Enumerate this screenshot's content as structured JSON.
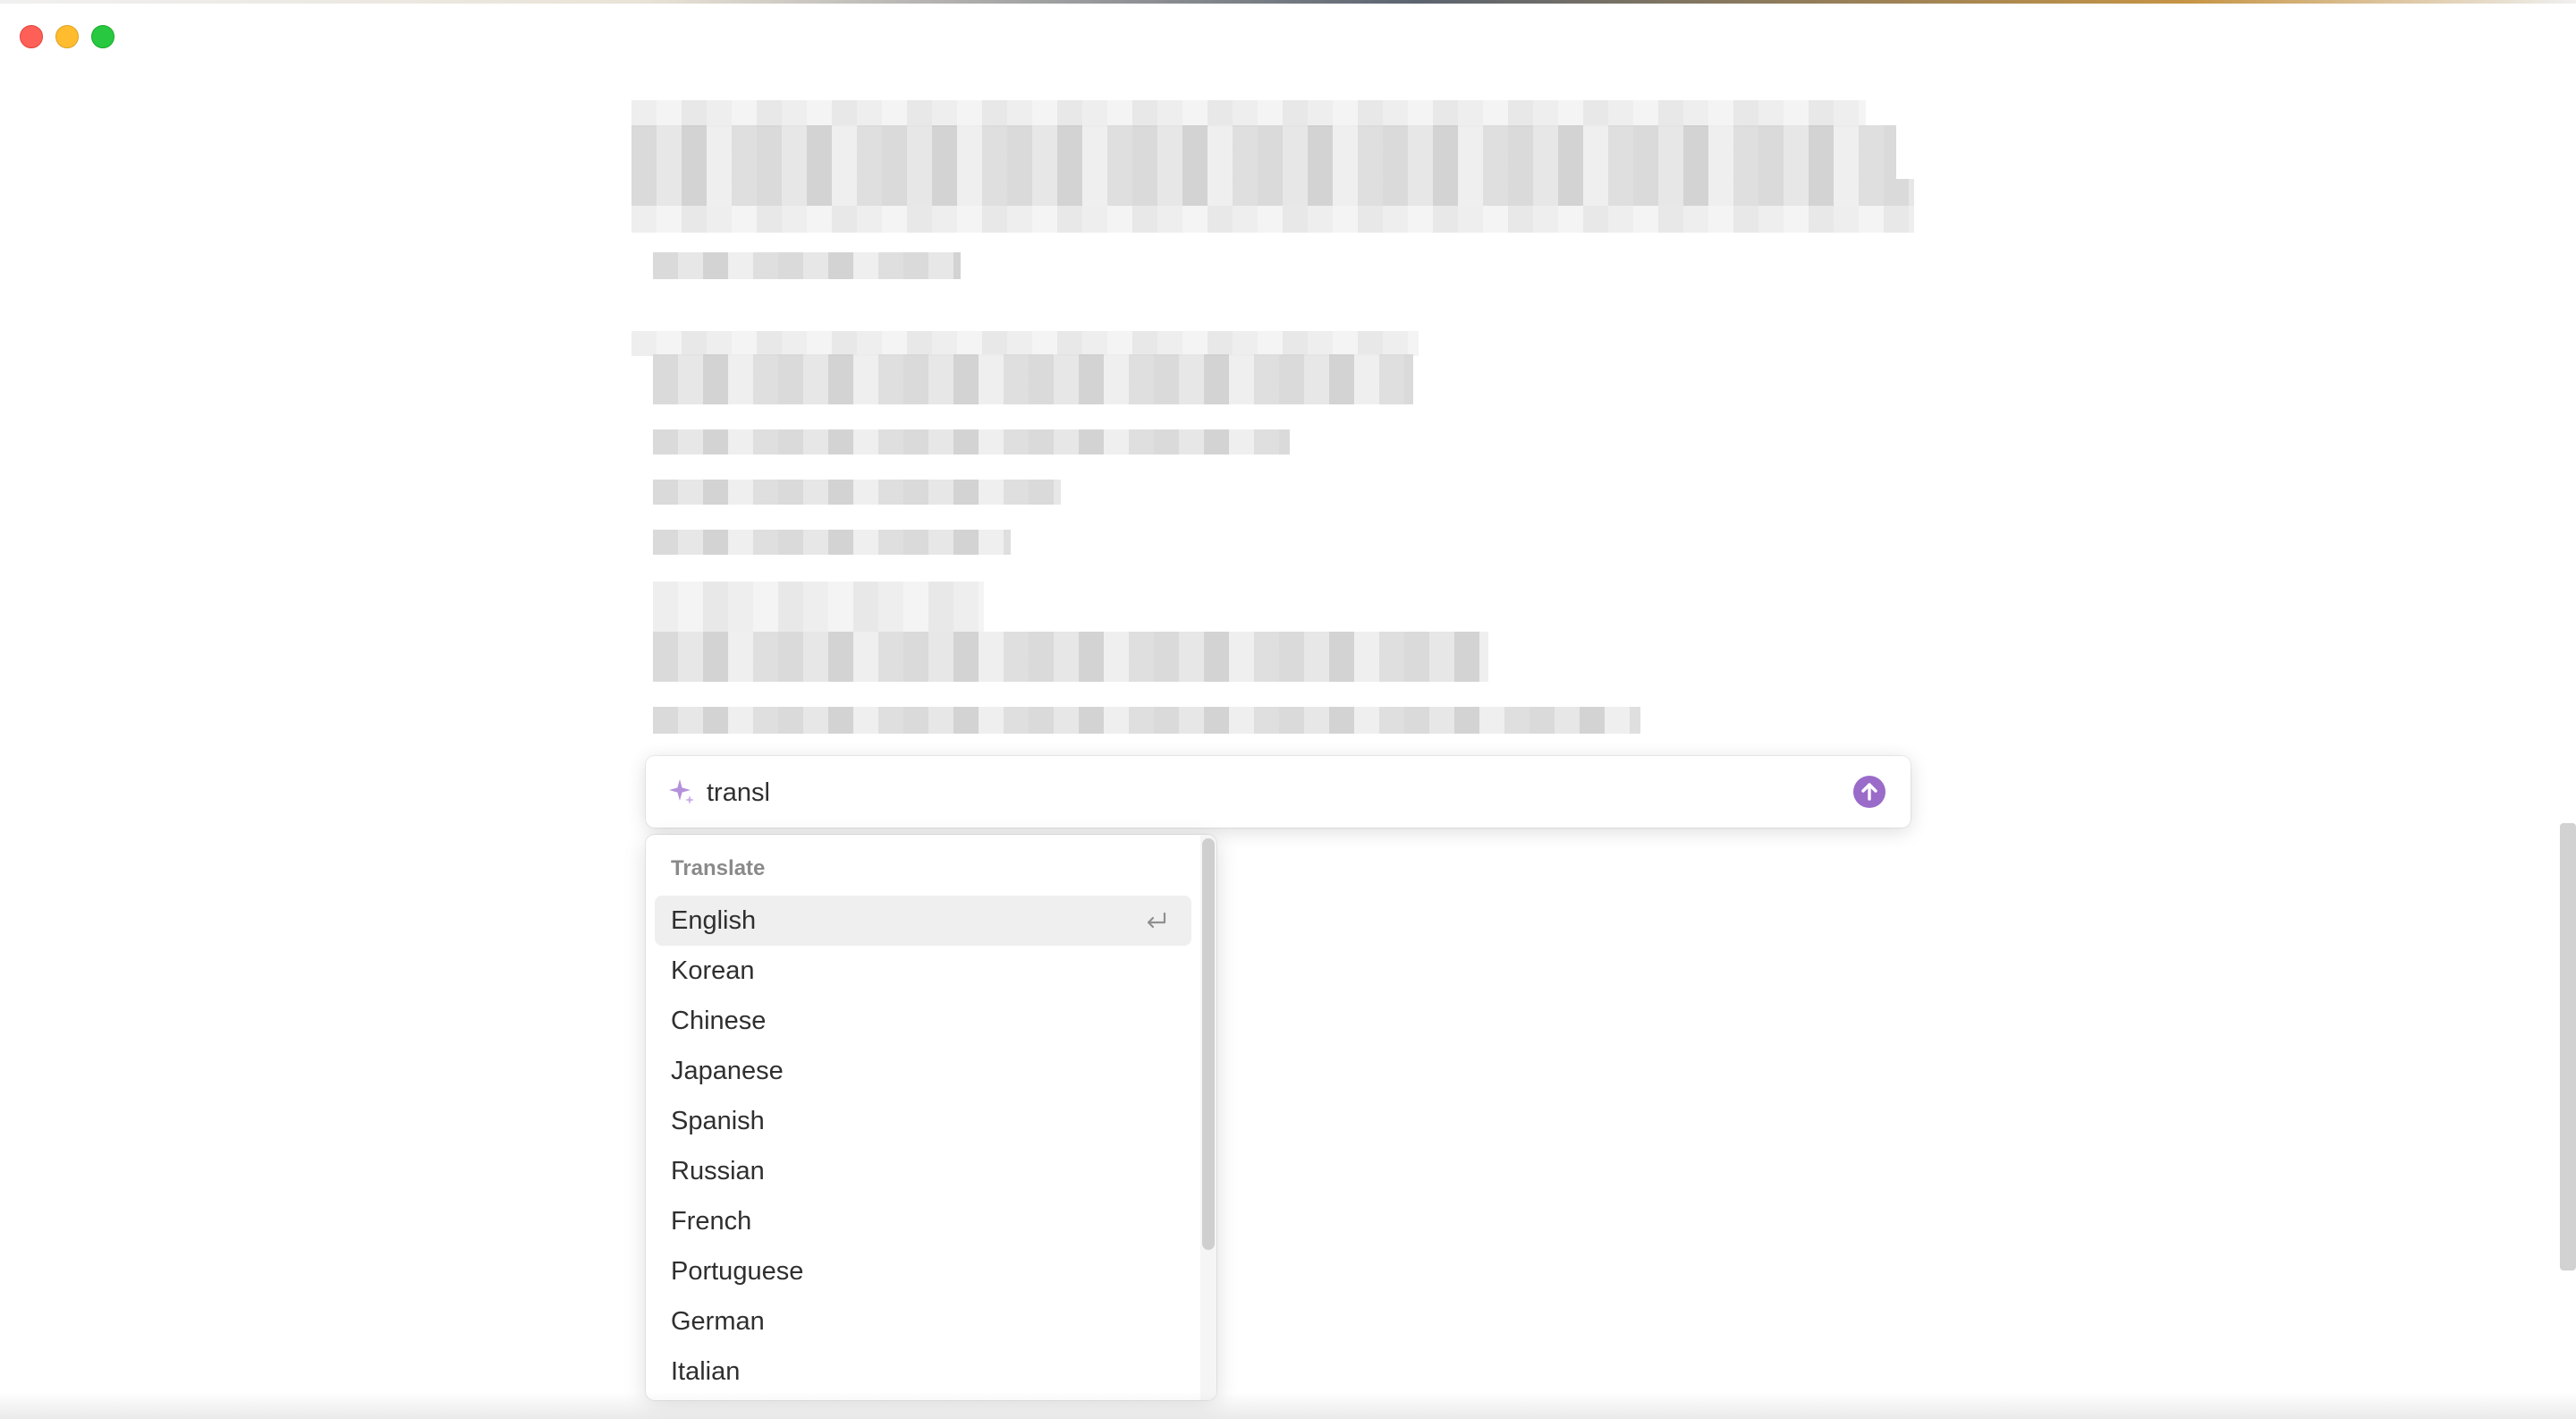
{
  "prompt": {
    "value": "transl",
    "icon": "sparkle-icon",
    "submit_icon": "arrow-up-icon",
    "accent_color": "#9b6bc9"
  },
  "menu": {
    "header": "Translate",
    "selected_index": 0,
    "items": [
      {
        "label": "English"
      },
      {
        "label": "Korean"
      },
      {
        "label": "Chinese"
      },
      {
        "label": "Japanese"
      },
      {
        "label": "Spanish"
      },
      {
        "label": "Russian"
      },
      {
        "label": "French"
      },
      {
        "label": "Portuguese"
      },
      {
        "label": "German"
      },
      {
        "label": "Italian"
      }
    ]
  }
}
